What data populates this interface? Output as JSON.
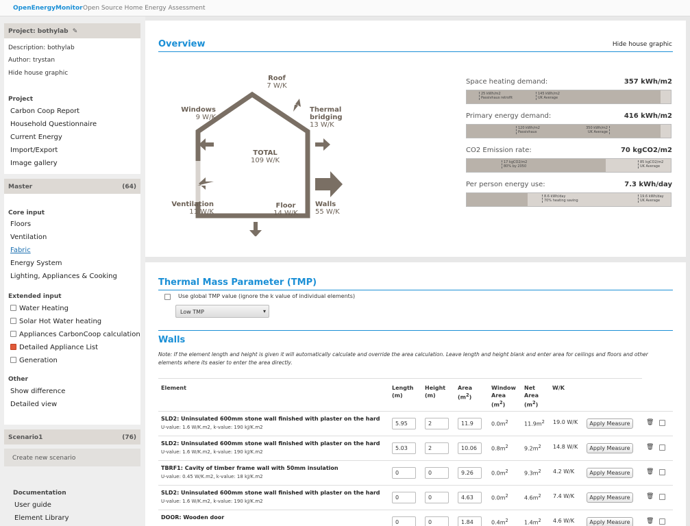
{
  "topbar": {
    "brand": "OpenEnergyMonitor",
    "tagline": "Open Source Home Energy Assessment"
  },
  "project": {
    "header": "Project: bothylab",
    "edit_icon": "edit-icon",
    "description": "Description: bothylab",
    "author": "Author: trystan",
    "hide_graphic": "Hide house graphic",
    "section_label": "Project",
    "links": [
      "Carbon Coop Report",
      "Household Questionnaire",
      "Current Energy",
      "Import/Export",
      "Image gallery"
    ]
  },
  "master": {
    "header": "Master",
    "count": "(64)",
    "core_label": "Core input",
    "core_links": [
      "Floors",
      "Ventilation",
      "Fabric",
      "Energy System",
      "Lighting, Appliances & Cooking"
    ],
    "extended_label": "Extended input",
    "extended_items": [
      {
        "label": "Water Heating",
        "checked": false
      },
      {
        "label": "Solar Hot Water heating",
        "checked": false
      },
      {
        "label": "Appliances CarbonCoop calculation",
        "checked": false
      },
      {
        "label": "Detailed Appliance List",
        "checked": true
      },
      {
        "label": "Generation",
        "checked": false
      }
    ],
    "other_label": "Other",
    "other_links": [
      "Show difference",
      "Detailed view"
    ]
  },
  "scenario": {
    "header": "Scenario1",
    "count": "(76)",
    "create": "Create new scenario"
  },
  "docs": {
    "label": "Documentation",
    "links": [
      "User guide",
      "Element Library"
    ]
  },
  "overview": {
    "title": "Overview",
    "hide_graphic": "Hide house graphic",
    "house": {
      "roof": {
        "label": "Roof",
        "value": "7 W/K"
      },
      "windows": {
        "label": "Windows",
        "value": "9 W/K"
      },
      "thermal_bridging": {
        "label": "Thermal bridging",
        "value": "13 W/K"
      },
      "total": {
        "label": "TOTAL",
        "value": "109 W/K"
      },
      "ventilation": {
        "label": "Ventilation",
        "value": "11 W/K"
      },
      "floor": {
        "label": "Floor",
        "value": "14 W/K"
      },
      "walls": {
        "label": "Walls",
        "value": "55 W/K"
      }
    },
    "metrics": [
      {
        "label": "Space heating demand:",
        "value": "357 kWh/m2",
        "fill": 0.95,
        "marks": [
          {
            "t1": "25 kWh/m2",
            "t2": "Passivhaus retrofit",
            "pos": 0.06,
            "r": false
          },
          {
            "t1": "145 kWh/m2",
            "t2": "UK Average",
            "pos": 0.34,
            "r": false
          }
        ]
      },
      {
        "label": "Primary energy demand:",
        "value": "416 kWh/m2",
        "fill": 0.95,
        "marks": [
          {
            "t1": "120 kWh/m2",
            "t2": "Passivhaus",
            "pos": 0.24,
            "r": false
          },
          {
            "t1": "350 kWh/m2",
            "t2": "UK Average",
            "pos": 0.7,
            "r": true
          }
        ]
      },
      {
        "label": "CO2 Emission rate:",
        "value": "70 kgCO2/m2",
        "fill": 0.68,
        "marks": [
          {
            "t1": "17 kgCO2/m2",
            "t2": "80% by 2050",
            "pos": 0.17,
            "r": false
          },
          {
            "t1": "85 kgCO2/m2",
            "t2": "UK Average",
            "pos": 0.84,
            "r": false
          }
        ]
      },
      {
        "label": "Per person energy use:",
        "value": "7.3 kWh/day",
        "fill": 0.3,
        "marks": [
          {
            "t1": "8.6 kWh/day",
            "t2": "70% heating saving",
            "pos": 0.37,
            "r": false
          },
          {
            "t1": "19.6 kWh/day",
            "t2": "UK Average",
            "pos": 0.84,
            "r": false
          }
        ]
      }
    ]
  },
  "tmp": {
    "title": "Thermal Mass Parameter (TMP)",
    "checkbox_label": "Use global TMP value (ignore the k value of individual elements)",
    "select_value": "Low TMP"
  },
  "walls": {
    "title": "Walls",
    "note": "Note: If the element length and height is given it will automatically calculate and override the area calculation. Leave length and height blank and enter area for ceilings and floors and other elements where its easier to enter the area directly.",
    "headers": {
      "element": "Element",
      "length": "Length",
      "length_u": "(m)",
      "height": "Height",
      "height_u": "(m)",
      "area": "Area",
      "area_u": "(m",
      "area_sup": "2",
      "area_close": ")",
      "win1": "Window",
      "win2": "Area",
      "win3": "(m",
      "win_sup": "2",
      "win_close": ")",
      "net1": "Net",
      "net2": "Area",
      "net3": "(m",
      "net_sup": "2",
      "net_close": ")",
      "wk": "W/K"
    },
    "apply_label": "Apply Measure",
    "trash_icon": "trash-icon",
    "rows": [
      {
        "name": "SLD2: Uninsulated 600mm stone wall finished with plaster on the hard",
        "sub": "U-value: 1.6 W/K.m2, k-value: 190 kJ/K.m2",
        "length": "5.95",
        "height": "2",
        "area": "11.9",
        "window": "0.0m",
        "net": "11.9m",
        "wk": "19.0 W/K"
      },
      {
        "name": "SLD2: Uninsulated 600mm stone wall finished with plaster on the hard",
        "sub": "U-value: 1.6 W/K.m2, k-value: 190 kJ/K.m2",
        "length": "5.03",
        "height": "2",
        "area": "10.06",
        "window": "0.8m",
        "net": "9.2m",
        "wk": "14.8 W/K"
      },
      {
        "name": "TBRF1: Cavity of timber frame wall with 50mm insulation",
        "sub": "U-value: 0.45 W/K.m2, k-value: 18 kJ/K.m2",
        "length": "0",
        "height": "0",
        "area": "9.26",
        "window": "0.0m",
        "net": "9.3m",
        "wk": "4.2 W/K"
      },
      {
        "name": "SLD2: Uninsulated 600mm stone wall finished with plaster on the hard",
        "sub": "U-value: 1.6 W/K.m2, k-value: 190 kJ/K.m2",
        "length": "0",
        "height": "0",
        "area": "4.63",
        "window": "0.0m",
        "net": "4.6m",
        "wk": "7.4 W/K"
      },
      {
        "name": "DOOR: Wooden door",
        "sub": "",
        "length": "0",
        "height": "0",
        "area": "1.84",
        "window": "0.4m",
        "net": "1.4m",
        "wk": "4.6 W/K"
      }
    ]
  }
}
